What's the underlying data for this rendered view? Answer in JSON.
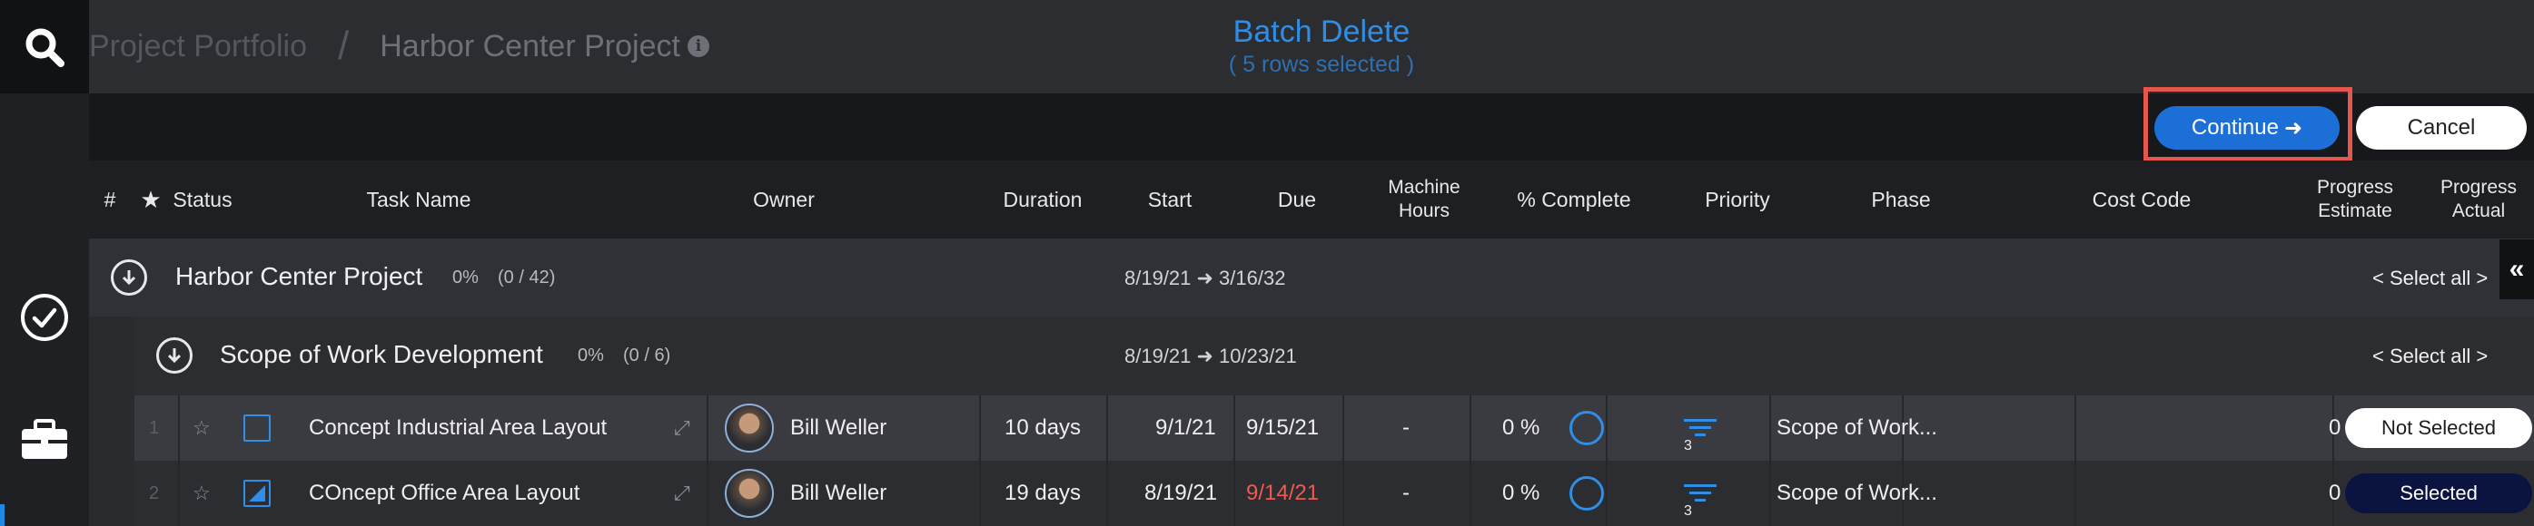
{
  "breadcrumb": {
    "root": "Project Portfolio",
    "separator": "/",
    "current": "Harbor Center Project",
    "info_icon": "i"
  },
  "batch": {
    "title": "Batch Delete",
    "subtitle": "( 5 rows selected )"
  },
  "actions": {
    "continue_label": "Continue",
    "continue_arrow": "➜",
    "cancel_label": "Cancel"
  },
  "rail": {
    "icons": [
      "search-icon",
      "check-circle-icon",
      "briefcase-icon"
    ]
  },
  "columns": {
    "num": "#",
    "star": "★",
    "status": "Status",
    "task_name": "Task Name",
    "owner": "Owner",
    "duration": "Duration",
    "start": "Start",
    "due": "Due",
    "machine_hours_1": "Machine",
    "machine_hours_2": "Hours",
    "pct_complete": "% Complete",
    "priority": "Priority",
    "phase": "Phase",
    "cost_code": "Cost Code",
    "progress_estimate_1": "Progress",
    "progress_estimate_2": "Estimate",
    "progress_actual_1": "Progress",
    "progress_actual_2": "Actual"
  },
  "groups": [
    {
      "name": "Harbor Center Project",
      "pct": "0%",
      "count": "(0 / 42)",
      "dates": "8/19/21 ➜ 3/16/32",
      "select_all": "< Select all >"
    },
    {
      "name": "Scope of Work Development",
      "pct": "0%",
      "count": "(0 / 6)",
      "dates": "8/19/21 ➜ 10/23/21",
      "select_all": "< Select all >"
    }
  ],
  "collapse_icon": "«",
  "rows": [
    {
      "num": "1",
      "task": "Concept Industrial Area Layout",
      "owner": "Bill Weller",
      "duration": "10 days",
      "start": "9/1/21",
      "due": "9/15/21",
      "due_overdue": false,
      "machine_hours": "-",
      "pct_complete": "0 %",
      "priority": "3",
      "phase": "Scope of Work...",
      "progress_actual": "0",
      "selection": "Not Selected",
      "checked": false
    },
    {
      "num": "2",
      "task": "COncept Office Area Layout",
      "owner": "Bill Weller",
      "duration": "19 days",
      "start": "8/19/21",
      "due": "9/14/21",
      "due_overdue": true,
      "machine_hours": "-",
      "pct_complete": "0 %",
      "priority": "3",
      "phase": "Scope of Work...",
      "progress_actual": "0",
      "selection": "Selected",
      "checked": true
    }
  ],
  "colors": {
    "accent": "#2f8ee6",
    "continue_button": "#1d6fd8",
    "highlight_border": "#e5574d",
    "overdue": "#f0594f",
    "selected_pill": "#0b1340"
  }
}
